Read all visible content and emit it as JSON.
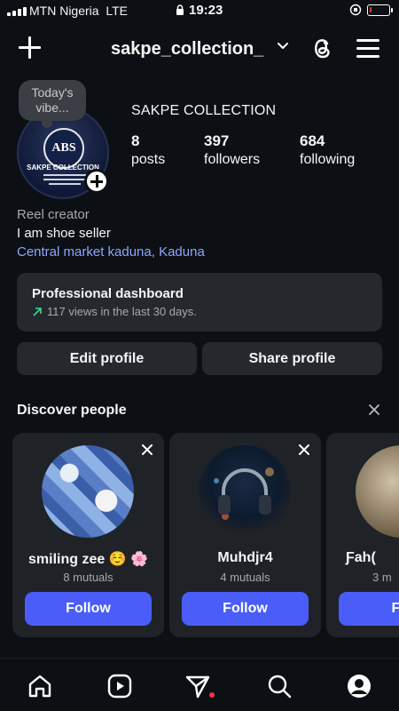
{
  "status_bar": {
    "carrier": "MTN Nigeria",
    "network": "LTE",
    "time": "19:23",
    "battery_level": 0.1
  },
  "header": {
    "username": "sakpe_collection_"
  },
  "profile": {
    "note": "Today's vibe...",
    "display_name": "SAKPE COLLECTION",
    "avatar_logo_text": "ABS",
    "avatar_brand_text": "SAKPE COLLECTION",
    "stats": [
      {
        "value": "8",
        "label": "posts"
      },
      {
        "value": "397",
        "label": "followers"
      },
      {
        "value": "684",
        "label": "following"
      }
    ],
    "category": "Reel creator",
    "bio": "I am shoe seller",
    "location": "Central market kaduna, Kaduna"
  },
  "dashboard": {
    "title": "Professional dashboard",
    "subtitle": "117 views in the last 30 days."
  },
  "actions": {
    "edit_profile": "Edit profile",
    "share_profile": "Share profile"
  },
  "discover": {
    "title": "Discover people",
    "cards": [
      {
        "name": "smiling zee ☺️ 🌸",
        "mutuals": "8 mutuals",
        "follow": "Follow"
      },
      {
        "name": "Muhdjr4",
        "mutuals": "4 mutuals",
        "follow": "Follow"
      },
      {
        "name": "Ƒah(",
        "mutuals": "3 m",
        "follow": "Fol"
      }
    ]
  },
  "colors": {
    "background": "#0c1014",
    "card": "#25292e",
    "accent_blue": "#4a5df9",
    "link_blue": "#8fa6ff",
    "notification_dot": "#ff3040"
  }
}
